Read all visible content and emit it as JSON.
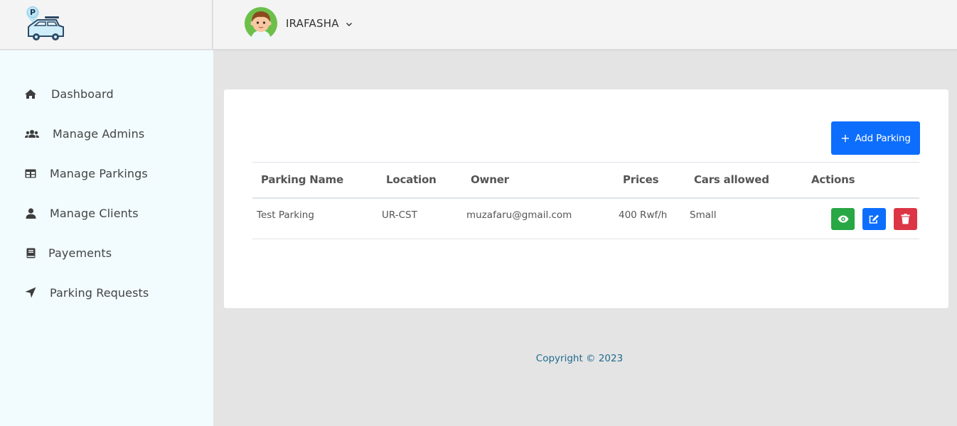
{
  "logo": {
    "badge": "P"
  },
  "user": {
    "name": "IRAFASHA"
  },
  "sidebar": {
    "items": [
      {
        "label": "Dashboard",
        "icon": "home-icon"
      },
      {
        "label": "Manage Admins",
        "icon": "users-icon"
      },
      {
        "label": "Manage Parkings",
        "icon": "table-icon"
      },
      {
        "label": "Manage Clients",
        "icon": "user-icon"
      },
      {
        "label": "Payements",
        "icon": "book-icon"
      },
      {
        "label": "Parking Requests",
        "icon": "location-arrow-icon"
      }
    ]
  },
  "main": {
    "add_button": "Add Parking",
    "table": {
      "headers": [
        "Parking Name",
        "Location",
        "Owner",
        "Prices",
        "Cars allowed",
        "Actions"
      ],
      "rows": [
        {
          "name": "Test Parking",
          "location": "UR-CST",
          "owner": "muzafaru@gmail.com",
          "price": "400 Rwf/h",
          "cars": "Small"
        }
      ]
    }
  },
  "footer": {
    "copyright": "Copyright © 2023"
  },
  "colors": {
    "primary": "#0d6efd",
    "success": "#28a745",
    "danger": "#dc3545",
    "sidebar_bg": "#f2fbfe",
    "footer_text": "#1f6b8f"
  }
}
